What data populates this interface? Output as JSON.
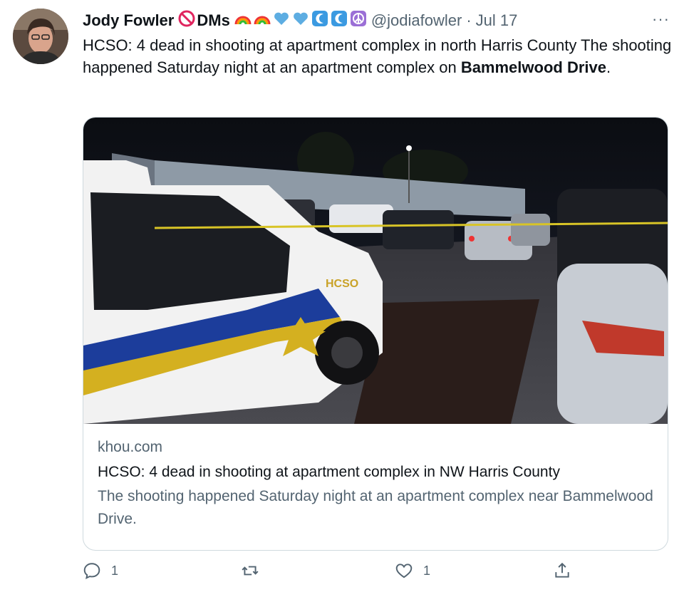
{
  "tweet": {
    "author_name": "Jody Fowler",
    "author_flair": "DMs",
    "handle": "@jodiafowler",
    "separator": "·",
    "date": "Jul 17",
    "more_label": "···",
    "text_prefix": "HCSO: 4 dead in shooting at apartment complex in north Harris County The shooting happened Saturday night at an apartment complex on ",
    "text_bold": "Bammelwood Drive",
    "text_suffix": "."
  },
  "card": {
    "domain": "khou.com",
    "title": "HCSO: 4 dead in shooting at apartment complex in NW Harris County",
    "description": "The shooting happened Saturday night at an apartment complex near Bammelwood Drive.",
    "image_text": "HCSO"
  },
  "actions": {
    "reply_count": "1",
    "like_count": "1"
  },
  "icons": [
    "no-entry-icon",
    "rainbow-icon",
    "blue-heart-icon",
    "wave-icon",
    "peace-icon",
    "reply-icon",
    "retweet-icon",
    "like-icon",
    "share-icon",
    "more-icon"
  ],
  "colors": {
    "text": "#0f1419",
    "muted": "#536471",
    "border": "#cfd9de"
  }
}
